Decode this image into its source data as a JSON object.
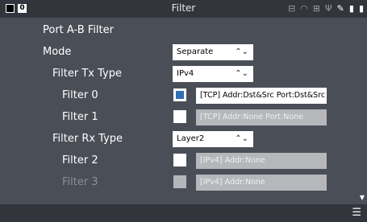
{
  "window": {
    "title": "Filter"
  },
  "status_icons": [
    "ethernet-icon",
    "wifi-icon",
    "network-icon",
    "usb-icon",
    "edit-icon",
    "sd-card-icon",
    "battery-icon"
  ],
  "badge": "0",
  "section_title": "Port A-B Filter",
  "mode": {
    "label": "Mode",
    "value": "Separate"
  },
  "tx_type": {
    "label": "Filter Tx Type",
    "value": "IPv4"
  },
  "filter0": {
    "label": "Filter 0",
    "checked": true,
    "value": "[TCP] Addr:Dst&Src  Port:Dst&Src"
  },
  "filter1": {
    "label": "Filter 1",
    "checked": false,
    "value": "[TCP] Addr:None  Port:None"
  },
  "rx_type": {
    "label": "Filter Rx Type",
    "value": "Layer2"
  },
  "filter2": {
    "label": "Filter 2",
    "checked": false,
    "value": "[IPv4] Addr:None"
  },
  "filter3": {
    "label": "Filter 3",
    "checked": false,
    "value": "[IPv4] Addr:None"
  },
  "colors": {
    "background": "#4a4e57",
    "bar": "#32353b",
    "accent": "#2f6fb3"
  }
}
